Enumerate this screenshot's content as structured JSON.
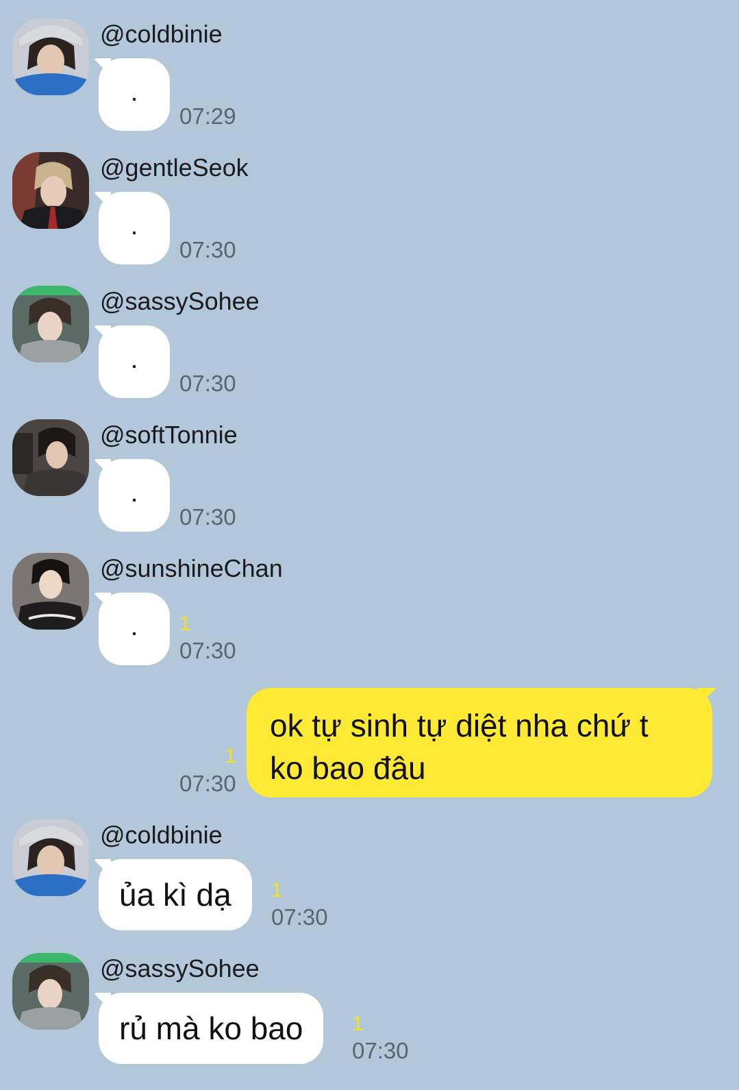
{
  "messages": [
    {
      "sender": "@coldbinie",
      "text": ".",
      "time": "07:29",
      "unread": ""
    },
    {
      "sender": "@gentleSeok",
      "text": ".",
      "time": "07:30",
      "unread": ""
    },
    {
      "sender": "@sassySohee",
      "text": ".",
      "time": "07:30",
      "unread": ""
    },
    {
      "sender": "@softTonnie",
      "text": ".",
      "time": "07:30",
      "unread": ""
    },
    {
      "sender": "@sunshineChan",
      "text": ".",
      "time": "07:30",
      "unread": "1"
    },
    {
      "sender": "@coldbinie",
      "text": "ủa kì dạ",
      "time": "07:30",
      "unread": "1"
    },
    {
      "sender": "@sassySohee",
      "text": "rủ mà ko bao",
      "time": "07:30",
      "unread": "1"
    }
  ],
  "my_message": {
    "line1": "ok tự sinh tự diệt nha chứ t",
    "line2": "ko bao đâu",
    "time": "07:30",
    "unread": "1"
  },
  "colors": {
    "background": "#b2c7da",
    "incoming_bubble": "#ffffff",
    "outgoing_bubble": "#fee934",
    "unread_count": "#f5e21b"
  },
  "icons": [
    "profile-photo-icon"
  ]
}
